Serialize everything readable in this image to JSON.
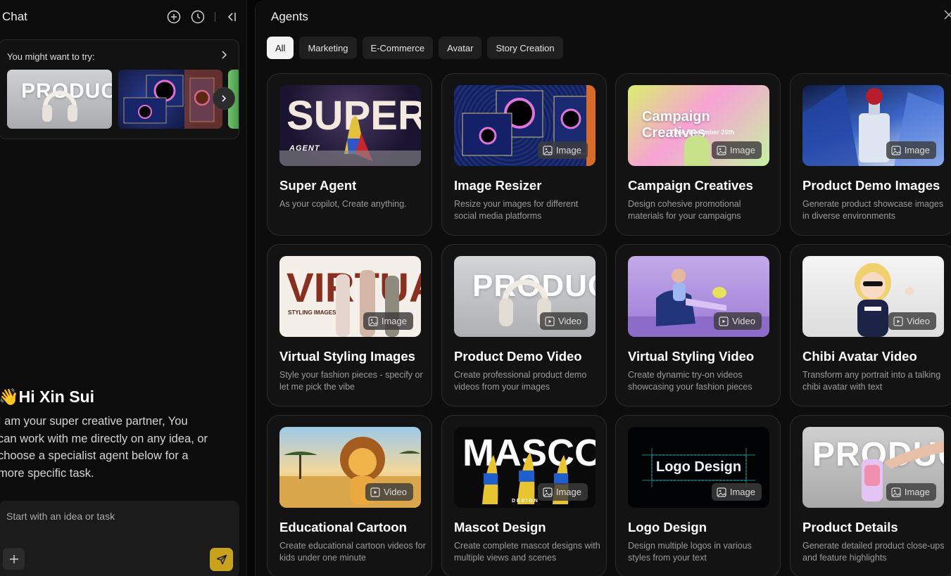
{
  "chat": {
    "title": "Chat",
    "suggest_title": "You might want to try:",
    "greeting": "👋Hi Xin Sui",
    "intro": "I am your super creative partner, You can work with me directly on any idea, or choose a specialist agent below for a more specific task.",
    "input_placeholder": "Start with an idea or task",
    "thumb_text": "PRODUCT"
  },
  "agents": {
    "title": "Agents",
    "tabs": [
      "All",
      "Marketing",
      "E-Commerce",
      "Avatar",
      "Story Creation"
    ],
    "active_tab": "All",
    "cards": [
      {
        "title": "Super Agent",
        "desc": "As your copilot, Create anything.",
        "badge": "",
        "img_text": "SUPER",
        "img_sub": "AGENT"
      },
      {
        "title": "Image Resizer",
        "desc": "Resize your images for different social media platforms",
        "badge": "Image",
        "img_text": "",
        "img_sub": ""
      },
      {
        "title": "Campaign Creatives",
        "desc": "Design cohesive promotional materials for your campaigns",
        "badge": "Image",
        "img_text": "Campaign Creatives",
        "img_sub": "Time: December 25th"
      },
      {
        "title": "Product Demo Images",
        "desc": "Generate product showcase images in diverse environments",
        "badge": "Image",
        "img_text": "",
        "img_sub": ""
      },
      {
        "title": "Virtual Styling Images",
        "desc": "Style your fashion pieces - specify or let me pick the vibe",
        "badge": "Image",
        "img_text": "VIRTUAL",
        "img_sub": "STYLING IMAGES"
      },
      {
        "title": "Product Demo Video",
        "desc": "Create professional product demo videos from your images",
        "badge": "Video",
        "img_text": "PRODUCT",
        "img_sub": ""
      },
      {
        "title": "Virtual Styling Video",
        "desc": "Create dynamic try-on videos showcasing your fashion pieces",
        "badge": "Video",
        "img_text": "",
        "img_sub": ""
      },
      {
        "title": "Chibi Avatar Video",
        "desc": "Transform any portrait into a talking chibi avatar with text",
        "badge": "Video",
        "img_text": "",
        "img_sub": ""
      },
      {
        "title": "Educational Cartoon",
        "desc": "Create educational cartoon videos for kids under one minute",
        "badge": "Video",
        "img_text": "",
        "img_sub": ""
      },
      {
        "title": "Mascot Design",
        "desc": "Create complete mascot designs with multiple views and scenes",
        "badge": "Image",
        "img_text": "MASCOT",
        "img_sub": "DESIGN"
      },
      {
        "title": "Logo Design",
        "desc": "Design multiple logos in various styles from your text",
        "badge": "Image",
        "img_text": "Logo Design",
        "img_sub": ""
      },
      {
        "title": "Product Details",
        "desc": "Generate detailed product close-ups and feature highlights",
        "badge": "Image",
        "img_text": "PRODUCT",
        "img_sub": ""
      }
    ]
  },
  "colors": {
    "accent": "#c9a21c",
    "bg": "#0d0d0d",
    "card": "#131313"
  },
  "icons": [
    "plus-circle-icon",
    "history-icon",
    "collapse-icon",
    "chevron-right-icon",
    "close-icon",
    "plus-icon",
    "send-icon",
    "image-icon",
    "video-icon"
  ]
}
